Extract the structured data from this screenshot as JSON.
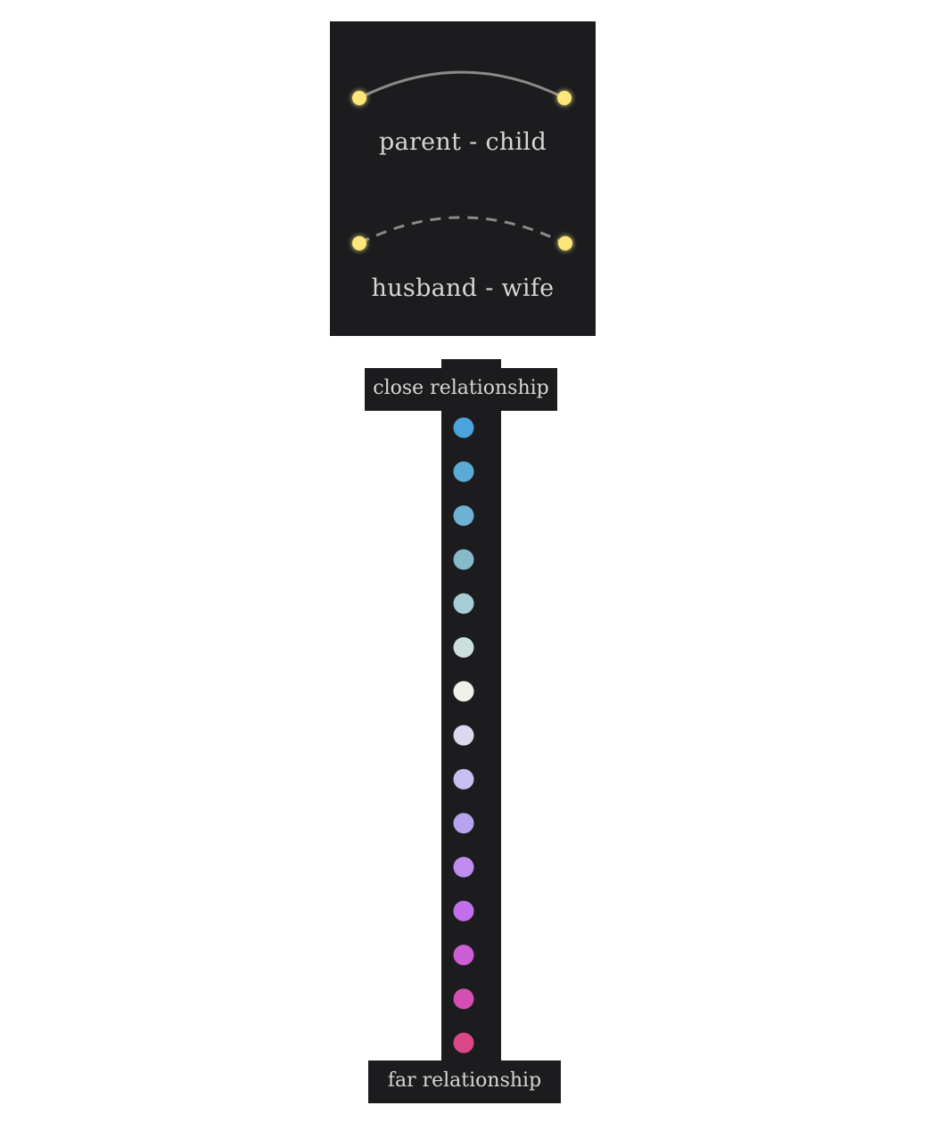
{
  "legend": {
    "items": [
      {
        "label": "parent - child",
        "line_style": "solid"
      },
      {
        "label": "husband - wife",
        "line_style": "dashed"
      }
    ],
    "node_color": "#fde77a",
    "edge_color": "#8a8a8a",
    "background": "#1c1c1f"
  },
  "scale": {
    "top_label": "close relationship",
    "bottom_label": "far relationship",
    "colors": [
      "#4aa3db",
      "#5aabd7",
      "#6fb1d2",
      "#86bacb",
      "#a6cdd3",
      "#c9e0dc",
      "#eef0ea",
      "#dcd8ef",
      "#c8c0f2",
      "#b8a3f0",
      "#bf8cf0",
      "#c16fea",
      "#cc5fd8",
      "#d54fb3",
      "#da4788"
    ]
  }
}
